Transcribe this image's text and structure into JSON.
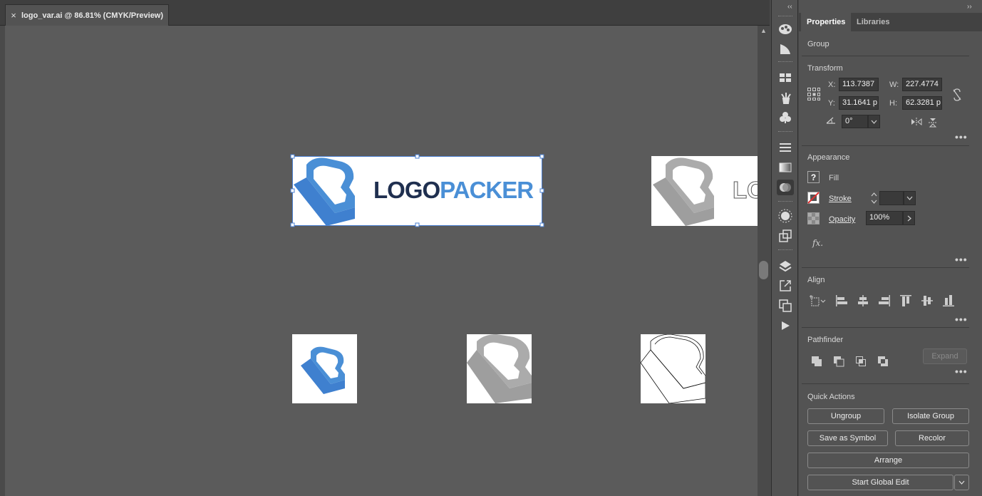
{
  "document": {
    "tab_title": "logo_var.ai @ 86.81% (CMYK/Preview)",
    "close_glyph": "×"
  },
  "artboard": {
    "wordmark_dark": "LOGO",
    "wordmark_blue": "PACKER",
    "wordmark_partial": "LO"
  },
  "colors": {
    "brand_blue": "#4a8fd6",
    "brand_dark": "#1f2f4f",
    "gray_logo": "#a9a9a9"
  },
  "panel": {
    "collapse_left": "‹‹",
    "collapse_right": "››",
    "tabs": [
      "Properties",
      "Libraries"
    ],
    "selection": "Group",
    "transform": {
      "title": "Transform",
      "x_label": "X:",
      "x_value": "113.7387",
      "y_label": "Y:",
      "y_value": "31.1641 p",
      "w_label": "W:",
      "w_value": "227.4774",
      "h_label": "H:",
      "h_value": "62.3281 p",
      "rotate_value": "0°"
    },
    "appearance": {
      "title": "Appearance",
      "fill_label": "Fill",
      "fill_glyph": "?",
      "stroke_label": "Stroke",
      "opacity_label": "Opacity",
      "opacity_value": "100%",
      "fx_label": "fx."
    },
    "align": {
      "title": "Align"
    },
    "pathfinder": {
      "title": "Pathfinder",
      "expand_label": "Expand"
    },
    "quick_actions": {
      "title": "Quick Actions",
      "ungroup": "Ungroup",
      "isolate_group": "Isolate Group",
      "save_as_symbol": "Save as Symbol",
      "recolor": "Recolor",
      "arrange": "Arrange",
      "start_global_edit": "Start Global Edit"
    },
    "more_glyph": "•••"
  }
}
